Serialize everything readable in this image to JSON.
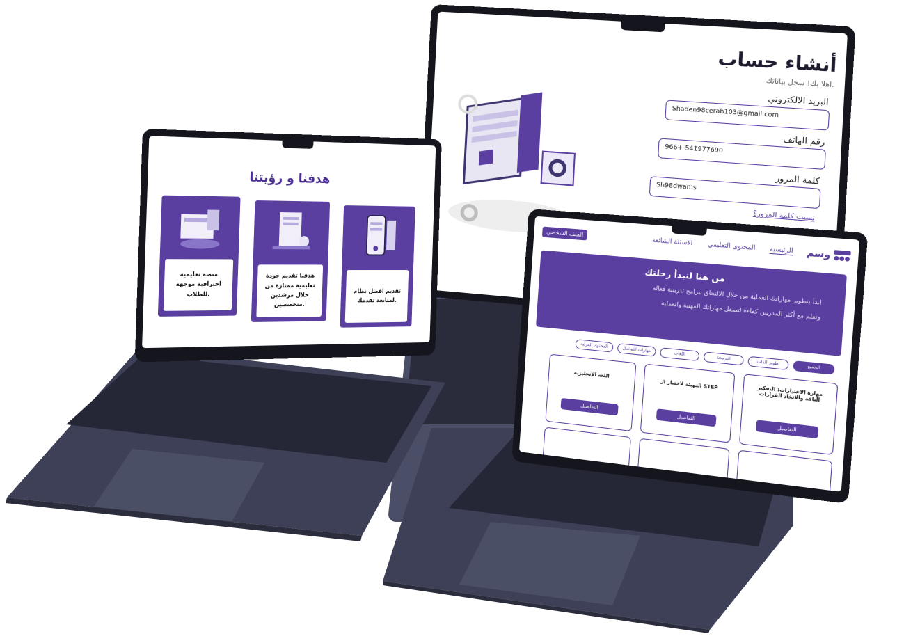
{
  "signup": {
    "title": "أنشاء حساب",
    "subtitle": "اهلا بك! سجل بياناتك.",
    "email_label": "البريد الالكتروني",
    "email_value": "Shaden98cerab103@gmail.com",
    "phone_label": "رقم الهاتف",
    "phone_value": "966+ 541977690",
    "password_label": "كلمة المرور",
    "password_value": "Sh98dwams",
    "forgot_link": "نسيت كلمة المرور؟"
  },
  "vision": {
    "title": "هدفنا و رؤيتنا",
    "cards": [
      {
        "text": "تقديم افضل نظام لمتابعة تقدمك."
      },
      {
        "text": "هدفنا تقديم جودة تعليمية ممتازة من خلال مرشدين متخصصين."
      },
      {
        "text": "منصة تعليمية احترافية موجهة للطلاب."
      }
    ]
  },
  "home": {
    "logo": "وسم",
    "nav": [
      "الرئيسية",
      "المحتوى التعليمي",
      "الاسئلة الشائعة"
    ],
    "profile_button": "الملف الشخصي",
    "hero_title": "من هنا لنبدأ رحلتك",
    "hero_line1": "ابدأ بتطوير مهاراتك العملية من خلال الالتحاق ببرامج تدريبية فعالة",
    "hero_line2": "وتعلم مع أكثر المدربين كفاءة لتصقل مهاراتك المهنية والعملية",
    "chips": [
      "الجميع",
      "تطوير الذات",
      "البرمجة",
      "اللغات",
      "مهارات التواصل",
      "المحتوى المرئية"
    ],
    "courses": [
      {
        "title": "مهارة الاختيارات: التفكير الناقد والاتخاذ القرارات",
        "button": "التفاصيل"
      },
      {
        "title": "التهيئة لاختبار ال STEP",
        "button": "التفاصيل"
      },
      {
        "title": "اللغة الانجليزية",
        "button": "التفاصيل"
      }
    ]
  },
  "colors": {
    "brand": "#5a3fa0",
    "laptop_body": "#3d4056",
    "bezel": "#14151d"
  }
}
